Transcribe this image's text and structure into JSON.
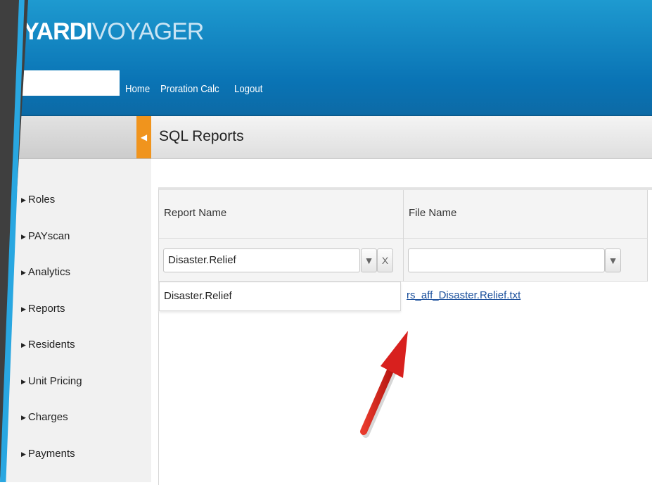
{
  "header": {
    "logo_primary": "YARDI",
    "logo_secondary": "VOYAGER",
    "nav": [
      "Home",
      "Proration Calc",
      "Logout"
    ]
  },
  "sidebar": {
    "items": [
      {
        "label": "Roles"
      },
      {
        "label": "PAYscan"
      },
      {
        "label": "Analytics"
      },
      {
        "label": "Reports"
      },
      {
        "label": "Residents"
      },
      {
        "label": "Unit Pricing"
      },
      {
        "label": "Charges"
      },
      {
        "label": "Payments"
      }
    ]
  },
  "main": {
    "title": "SQL Reports",
    "columns": [
      "Report Name",
      "File Name"
    ],
    "filters": {
      "report_name": "Disaster.Relief",
      "file_name": "",
      "clear_glyph": "X"
    },
    "rows": [
      {
        "report_name": "Disaster.Relief",
        "file_name": "rs_aff_Disaster.Relief.txt"
      }
    ]
  },
  "colors": {
    "header_blue": "#0a74b5",
    "accent_orange": "#f0941d",
    "link_blue": "#1a4f9c",
    "annotation_red": "#d8201e"
  },
  "icons": [
    "filter-icon",
    "clear-filter-icon",
    "collapse-chevron-icon",
    "caret-right-icon",
    "annotation-arrow-icon"
  ]
}
